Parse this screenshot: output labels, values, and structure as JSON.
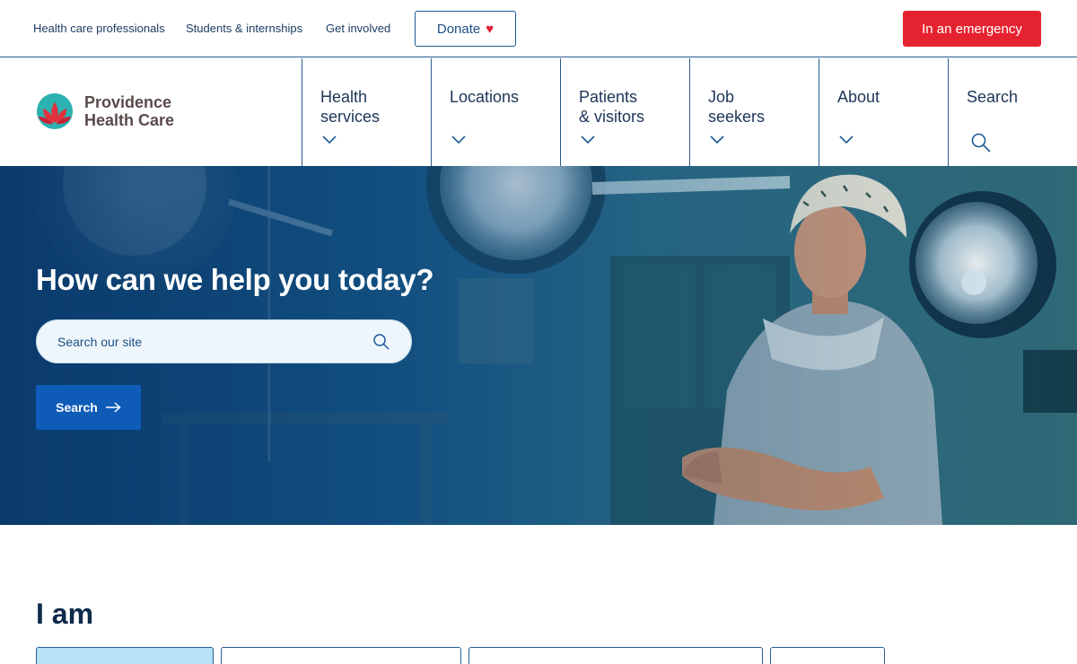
{
  "utility": {
    "links": [
      "Health care professionals",
      "Students & internships",
      "Get involved"
    ],
    "donate_label": "Donate",
    "emergency_label": "In an emergency"
  },
  "logo": {
    "line1": "Providence",
    "line2": "Health Care"
  },
  "nav": {
    "items": [
      {
        "line1": "Health",
        "line2": "services"
      },
      {
        "line1": "Locations",
        "line2": ""
      },
      {
        "line1": "Patients",
        "line2": "& visitors"
      },
      {
        "line1": "Job",
        "line2": "seekers"
      },
      {
        "line1": "About",
        "line2": ""
      },
      {
        "line1": "Search",
        "line2": ""
      }
    ]
  },
  "hero": {
    "title": "How can we help you today?",
    "search_placeholder": "Search our site",
    "search_button": "Search"
  },
  "iam": {
    "title": "I am"
  },
  "colors": {
    "brand_navy": "#1d3557",
    "emergency_red": "#e52330",
    "search_blue": "#0e5bb8",
    "logo_teal": "#2bb1b0",
    "logo_red": "#e0323f"
  }
}
